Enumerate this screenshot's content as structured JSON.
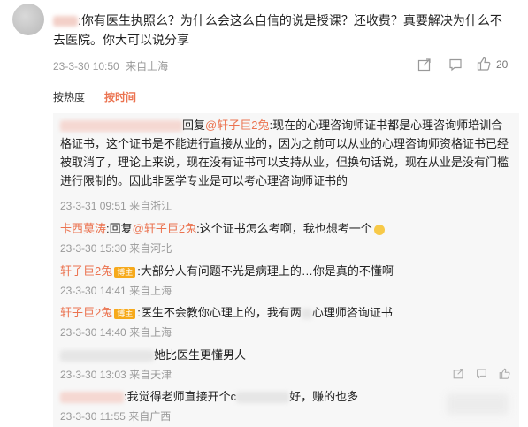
{
  "main_comment": {
    "text": ":你有医生执照么？为什么会这么自信的说是授课？还收费？真要解决为什么不去医院。你大可以说分享",
    "time": "23-3-30 10:50",
    "location": "来自上海",
    "like_count": "20"
  },
  "sort_tabs": {
    "hot": "按热度",
    "time": "按时间"
  },
  "replies": [
    {
      "prefix": "回复",
      "mention": "@轩子巨2兔",
      "text": ":现在的心理咨询师证书都是心理咨询师培训合格证书，这个证书是不能进行直接从业的，因为之前可以从业的心理咨询师资格证书已经被取消了，理论上来说，现在没有证书可以支持从业，但换句话说，现在从业是没有门槛进行限制的。因此非医学专业是可以考心理咨询师证书的",
      "time": "23-3-31 09:51",
      "location": "来自浙江"
    },
    {
      "nick": "卡西莫涛",
      "prefix": ":回复",
      "mention": "@轩子巨2兔",
      "text": ":这个证书怎么考啊，我也想考一个",
      "time": "23-3-30 15:30",
      "location": "来自河北"
    },
    {
      "nick": "轩子巨2兔",
      "badge": "博主",
      "text": ":大部分人有问题不光是病理上的…你是真的不懂啊",
      "time": "23-3-30 14:41",
      "location": "来自上海"
    },
    {
      "nick": "轩子巨2兔",
      "badge": "博主",
      "text_a": ":医生不会教你心理上的，我有两",
      "text_b": "心理师咨询证书",
      "time": "23-3-30 14:40",
      "location": "来自上海"
    },
    {
      "text": "她比医生更懂男人",
      "time": "23-3-30 13:03",
      "location": "来自天津"
    },
    {
      "text_a": ":我觉得老师直接开个c",
      "text_b": "好，赚的也多",
      "time": "23-3-30 11:55",
      "location": "来自广西"
    }
  ],
  "icons": [
    "share-icon",
    "comment-icon",
    "like-icon",
    "more-icon"
  ],
  "colors": {
    "accent": "#eb7350",
    "badge": "#f6a91b",
    "meta": "#999999",
    "panel": "#f7f7f7"
  }
}
